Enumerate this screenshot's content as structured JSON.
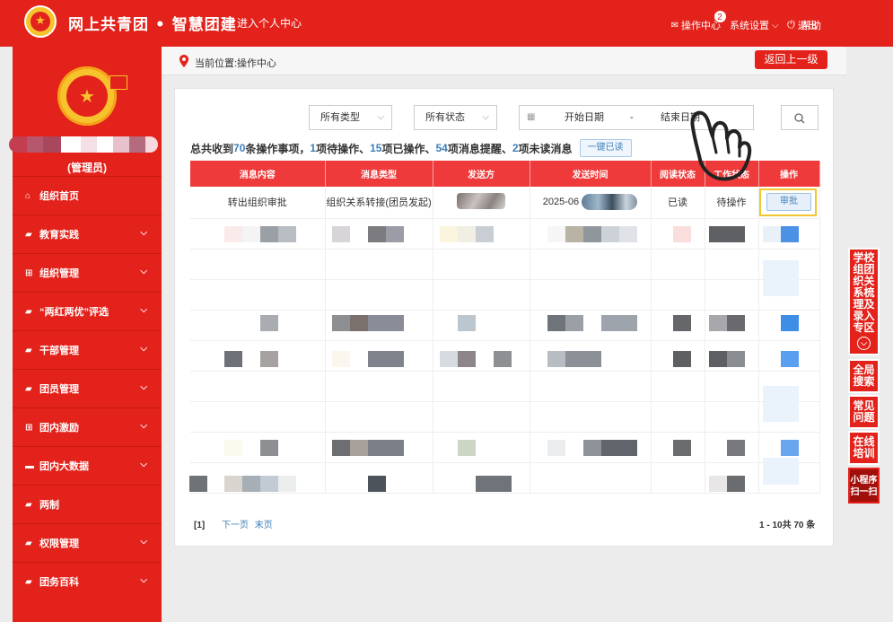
{
  "header": {
    "site_title": "网上共青团 • 智慧团建",
    "personal_center": "进入个人中心",
    "ops_center": "操作中心",
    "ops_badge": "2",
    "settings": "系统设置",
    "help": "帮助",
    "logout": "退出"
  },
  "sidebar": {
    "role": "(管理员)",
    "items": [
      {
        "label": "组织首页"
      },
      {
        "label": "教育实践"
      },
      {
        "label": "组织管理"
      },
      {
        "label": "“两红两优”评选"
      },
      {
        "label": "干部管理"
      },
      {
        "label": "团员管理"
      },
      {
        "label": "团内激励"
      },
      {
        "label": "团内大数据"
      },
      {
        "label": "两制"
      },
      {
        "label": "权限管理"
      },
      {
        "label": "团务百科"
      }
    ]
  },
  "breadcrumb": {
    "text": "当前位置:操作中心",
    "back_label": "返回上一级"
  },
  "filters": {
    "type_label": "所有类型",
    "status_label": "所有状态",
    "start_date": "开始日期",
    "date_sep": "-",
    "end_date": "结束日期"
  },
  "summary": {
    "p1": "总共收到",
    "total": "70",
    "p2": "条操作事项，",
    "pending": "1",
    "p3": "项待操作、",
    "done": "15",
    "p4": "项已操作、",
    "reminders": "54",
    "p5": "项消息提醒、",
    "unread": "2",
    "p6": "项未读消息",
    "mark_all_read": "一键已读"
  },
  "table": {
    "headers": [
      "消息内容",
      "消息类型",
      "发送方",
      "发送时间",
      "阅读状态",
      "工作状态",
      "操作"
    ],
    "first_row": {
      "content": "转出组织审批",
      "type": "组织关系转接(团员发起)",
      "time_prefix": "2025-06",
      "read_status": "已读",
      "work_status": "待操作",
      "action": "审批"
    }
  },
  "pager": {
    "current": "[1]",
    "next": "下一页",
    "last": "末页",
    "summary": "1 - 10共 70 条"
  },
  "float_panel": {
    "school_zone": "学校组团织关系梳理及录入专区",
    "global_search": "全局搜索",
    "faq": "常见问题",
    "online_training": "在线培训",
    "mini_program": "小程序扫一扫"
  },
  "colors": {
    "brand_red": "#e3221b",
    "table_header_red": "#ee3a3a",
    "link_blue": "#3d7fb8",
    "highlight_yellow": "#f3c630"
  }
}
